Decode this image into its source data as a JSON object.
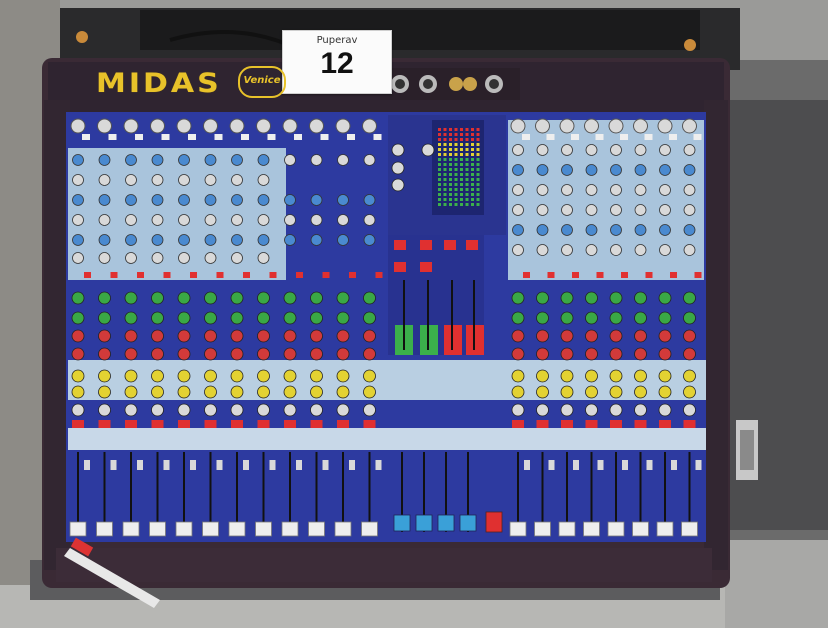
{
  "lot_card": {
    "label": "Puperav",
    "number": "12"
  },
  "console": {
    "brand": "MIDAS",
    "model": "Venice"
  },
  "colors": {
    "panel_blue": "#2d3aa0",
    "panel_light": "#a9c4dc",
    "chassis": "#3a2a35",
    "knob_green": "#3aa845",
    "knob_red": "#d23a3a",
    "knob_yellow": "#e3d232",
    "knob_blue": "#4a8ad0",
    "button_red": "#e03030",
    "brand_yellow": "#e8c22a"
  }
}
